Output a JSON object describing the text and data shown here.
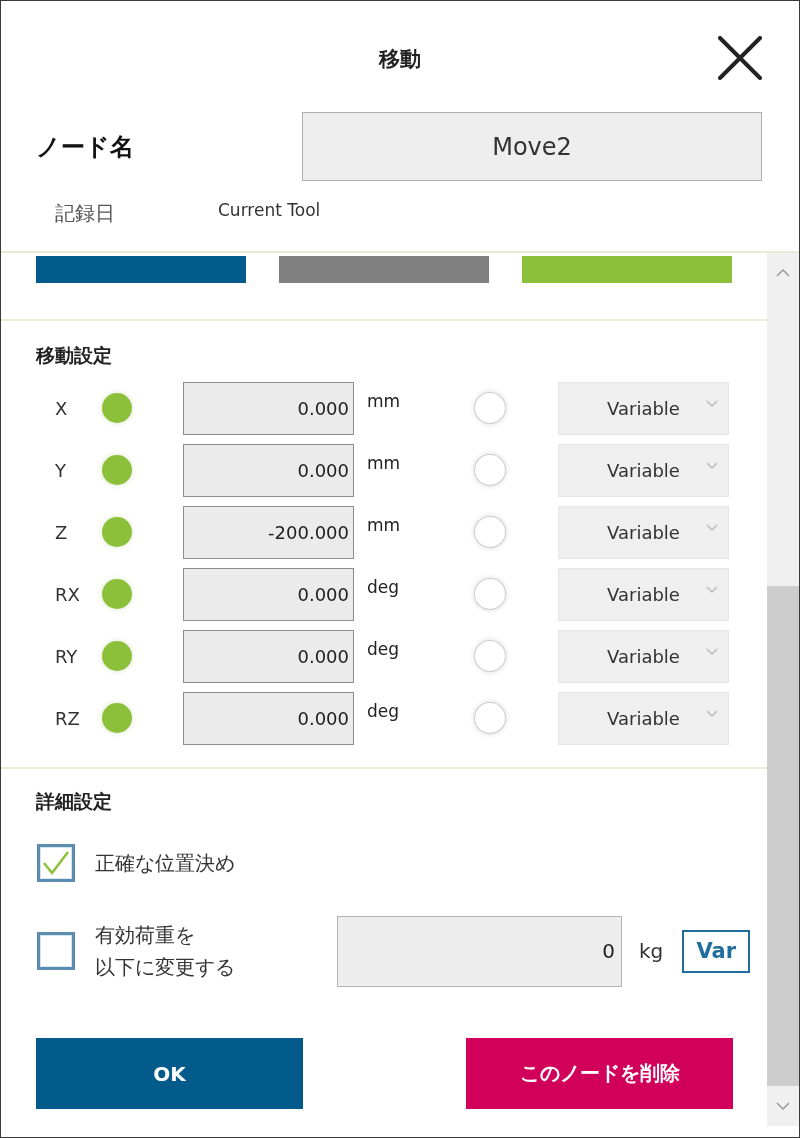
{
  "window": {
    "title": "移動"
  },
  "node_name": {
    "label": "ノード名",
    "value": "Move2"
  },
  "record": {
    "label": "記録日",
    "value": "Current Tool"
  },
  "top_bars": [
    {
      "color": "#035b8c"
    },
    {
      "color": "#808080"
    },
    {
      "color": "#8cbf3a"
    }
  ],
  "move_settings": {
    "title": "移動設定",
    "rows": [
      {
        "axis": "X",
        "value": "0.000",
        "unit": "mm",
        "value_selected": true,
        "variable": "Variable",
        "variable_selected": false
      },
      {
        "axis": "Y",
        "value": "0.000",
        "unit": "mm",
        "value_selected": true,
        "variable": "Variable",
        "variable_selected": false
      },
      {
        "axis": "Z",
        "value": "-200.000",
        "unit": "mm",
        "value_selected": true,
        "variable": "Variable",
        "variable_selected": false
      },
      {
        "axis": "RX",
        "value": "0.000",
        "unit": "deg",
        "value_selected": true,
        "variable": "Variable",
        "variable_selected": false
      },
      {
        "axis": "RY",
        "value": "0.000",
        "unit": "deg",
        "value_selected": true,
        "variable": "Variable",
        "variable_selected": false
      },
      {
        "axis": "RZ",
        "value": "0.000",
        "unit": "deg",
        "value_selected": true,
        "variable": "Variable",
        "variable_selected": false
      }
    ]
  },
  "detail_settings": {
    "title": "詳細設定",
    "options": [
      {
        "kind": "plain",
        "label_lines": [
          "正確な位置決め"
        ],
        "checked": true
      },
      {
        "kind": "payload",
        "label_lines": [
          "有効荷重を",
          "以下に変更する"
        ],
        "checked": false,
        "value": "0",
        "unit": "kg",
        "button": "Var"
      }
    ]
  },
  "buttons": [
    {
      "kind": "primary",
      "label": "OK"
    },
    {
      "kind": "danger",
      "label": "このノードを削除"
    }
  ]
}
